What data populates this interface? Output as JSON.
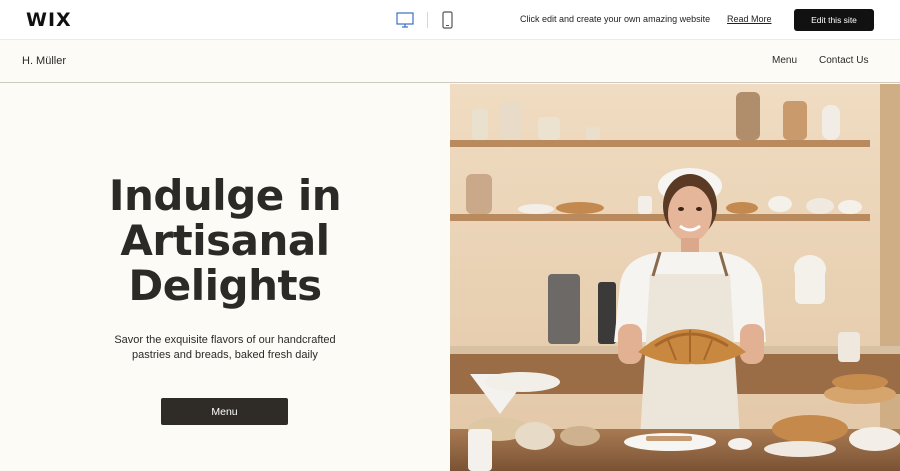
{
  "wix_bar": {
    "logo": "WIX",
    "promo_text": "Click edit and create your own amazing website",
    "read_more": "Read More",
    "edit_button": "Edit this site",
    "icons": [
      "desktop-icon",
      "mobile-icon"
    ]
  },
  "site_header": {
    "logo": "H. Müller",
    "nav": [
      "Menu",
      "Contact Us"
    ]
  },
  "hero": {
    "title_lines": [
      "Indulge in",
      "Artisanal",
      "Delights"
    ],
    "subtitle": "Savor the exquisite flavors of our handcrafted pastries and breads, baked fresh daily",
    "button": "Menu"
  },
  "colors": {
    "page_bg": "#fdfbf6",
    "text": "#2b2a27",
    "button_dark": "#2f2c28",
    "wix_button": "#111111"
  }
}
